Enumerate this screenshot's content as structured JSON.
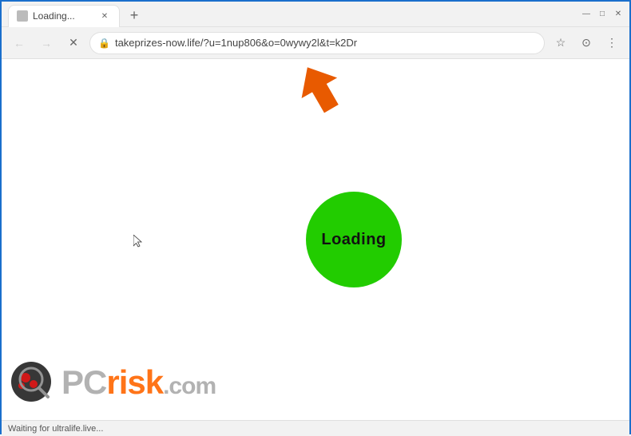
{
  "window": {
    "title": "Loading...",
    "tab_title": "Loading...",
    "new_tab_label": "+",
    "minimize_label": "—",
    "maximize_label": "□",
    "close_label": "✕"
  },
  "navbar": {
    "back_label": "←",
    "forward_label": "→",
    "reload_label": "✕",
    "url": "takeprizes-now.life/?u=1nup806&o=0wywy2l&t=k2Dr",
    "bookmark_label": "☆",
    "account_label": "⊙",
    "menu_label": "⋮"
  },
  "page": {
    "loading_text": "Loading",
    "loading_circle_color": "#22cc00"
  },
  "status_bar": {
    "text": "Waiting for ultralife.live..."
  },
  "watermark": {
    "pc_text": "PC",
    "risk_text": "risk",
    "com_text": ".com"
  }
}
